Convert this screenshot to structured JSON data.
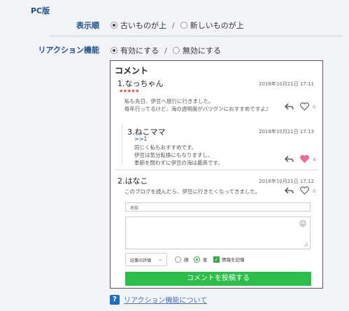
{
  "header": {
    "section": "PC版"
  },
  "settings": {
    "order": {
      "label": "表示順",
      "options": [
        "古いものが上",
        "新しいものが上"
      ],
      "selected": 0
    },
    "reaction": {
      "label": "リアクション機能",
      "options": [
        "有効にする",
        "無効にする"
      ],
      "selected": 0
    },
    "separator": "/"
  },
  "comments": {
    "title": "コメント",
    "items": [
      {
        "name": "1.なっちゃん",
        "date": "2018年10月21日 17:11",
        "stars": "★★★★★",
        "lines": [
          "私も先日、伊豆へ旅行に行きました。",
          "毎年行ってるけど、海の透明度がバツグンにおすすめですよ♪"
        ],
        "likes": "0"
      },
      {
        "name": "3.ねこママ",
        "date": "2018年10月21日 17:13",
        "reply_to": ">>1",
        "lines": [
          "同じく私もおすすめです。",
          "伊豆は気分転換にもなりますし、",
          "季節を問わずに伊豆の海は最高です。"
        ],
        "likes": "4"
      },
      {
        "name": "2.はなこ",
        "date": "2018年10月21日 17:12",
        "lines": [
          "このブログを読んだら、伊豆に行きたくなってきました。"
        ],
        "likes": "0"
      }
    ]
  },
  "form": {
    "name_placeholder": "名前",
    "rating_label": "記事の評価",
    "rating_options": [
      "顔",
      "星"
    ],
    "remember_label": "情報を記憶",
    "submit_label": "コメントを投稿する"
  },
  "help": {
    "icon": "?",
    "link": "リアクション機能について"
  },
  "colors": {
    "accent": "#2dbd4b",
    "label": "#1f4e8c",
    "heart_active": "#f06b8e",
    "star": "#e23d3d"
  }
}
